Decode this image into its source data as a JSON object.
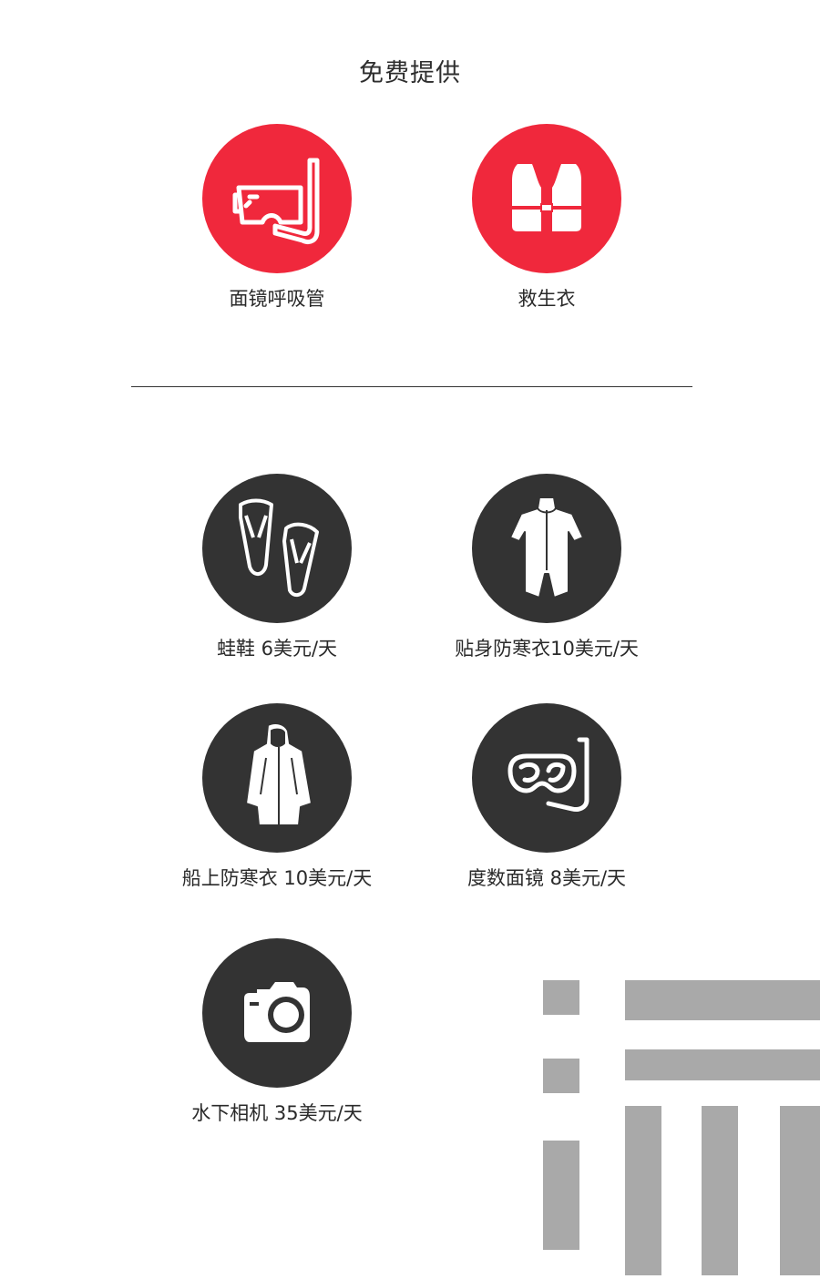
{
  "free_section": {
    "title": "免费提供",
    "items": [
      {
        "label": "面镜呼吸管",
        "icon": "snorkel-mask-icon",
        "color": "#f0283c"
      },
      {
        "label": "救生衣",
        "icon": "life-vest-icon",
        "color": "#f0283c"
      }
    ]
  },
  "rental_section": {
    "items": [
      {
        "label": "蛙鞋 6美元/天",
        "icon": "fins-icon"
      },
      {
        "label": "贴身防寒衣10美元/天",
        "icon": "wetsuit-icon"
      },
      {
        "label": "船上防寒衣 10美元/天",
        "icon": "jacket-icon"
      },
      {
        "label": "度数面镜 8美元/天",
        "icon": "diving-mask-icon"
      },
      {
        "label": "水下相机 35美元/天",
        "icon": "camera-icon"
      }
    ],
    "circle_color": "#333333"
  },
  "colors": {
    "accent_red": "#f0283c",
    "dark_circle": "#333333",
    "watermark_gray": "#a9a9a9"
  }
}
